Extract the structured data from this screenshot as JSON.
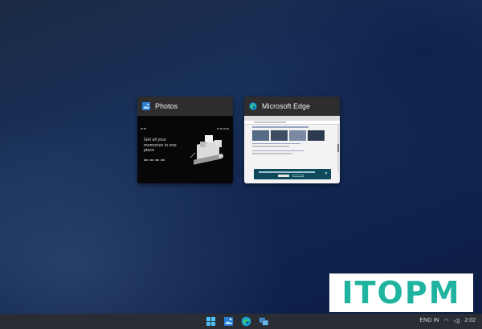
{
  "switcher": {
    "windows": [
      {
        "title": "Photos",
        "icon": "photos-icon"
      },
      {
        "title": "Microsoft Edge",
        "icon": "edge-icon"
      }
    ]
  },
  "photos_preview": {
    "headline": "Get all your memories in one place"
  },
  "watermark": {
    "text": "ITOPM",
    "color": "#1fb3a0"
  },
  "taskbar": {
    "icons": [
      "start-icon",
      "photos-icon",
      "edge-icon",
      "task-view-icon"
    ],
    "tray": {
      "lang": "ENG IN",
      "clock": "2:02"
    }
  },
  "colors": {
    "accent": "#0078d4",
    "taskbar": "#2a2d33"
  }
}
